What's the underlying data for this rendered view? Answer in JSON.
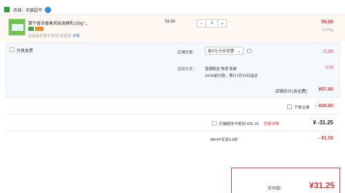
{
  "store": {
    "label": "店铺：天猫超市",
    "icon": "store-icon",
    "badge_icon": "tmall-badge-icon"
  },
  "item": {
    "title": "蒙牛香浓香蕉风味发酵乳100g*...",
    "return_note": "此商品任意不支持7天退货",
    "return_link": "详情",
    "unit_price": "59.80",
    "quantity": "1",
    "decrease_label": "−",
    "increase_label": "+",
    "total": "59.80",
    "weight": "1.37kg"
  },
  "options": {
    "invoice_label": "开具发票",
    "coupon_label": "店铺优惠：",
    "coupon_selected": "省2元:行业优惠",
    "coupon_amount": "-2.00",
    "shipping_label": "运送方式：",
    "shipping_line1": "普通配送 快递 免邮",
    "shipping_line2": "24:00前付款，预计7月15日送达",
    "shipping_amount": "0.00",
    "store_total_label": "店铺合计(含运费)",
    "store_total_value": "¥57.80"
  },
  "summary": {
    "discount_label": "下单立减",
    "discount_value": "- ¥24.90",
    "card_label": "天猫超市卡抵扣 ¥31.25",
    "card_link": "查看详情",
    "card_value": "¥ -31.25",
    "vip_label": "88VIP专享9.5折",
    "vip_value": "- ¥1.55",
    "final_label": "实付款：",
    "final_value": "¥31.25"
  },
  "colors": {
    "accent": "#e4393c",
    "panel_bg": "#f5f9fd",
    "item_bg": "#fff7f1"
  }
}
